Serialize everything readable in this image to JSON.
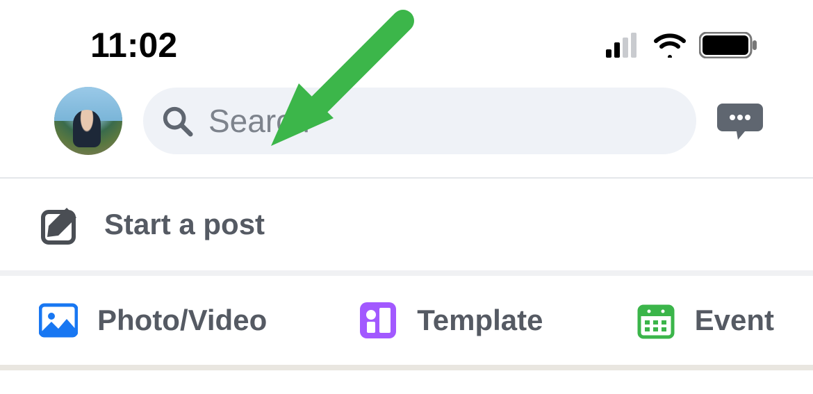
{
  "status": {
    "time": "11:02"
  },
  "header": {
    "search_placeholder": "Search"
  },
  "compose": {
    "label": "Start a post"
  },
  "actions": {
    "photo_label": "Photo/Video",
    "template_label": "Template",
    "event_label": "Event"
  },
  "annotation": {
    "arrow_color": "#3cb64a"
  }
}
